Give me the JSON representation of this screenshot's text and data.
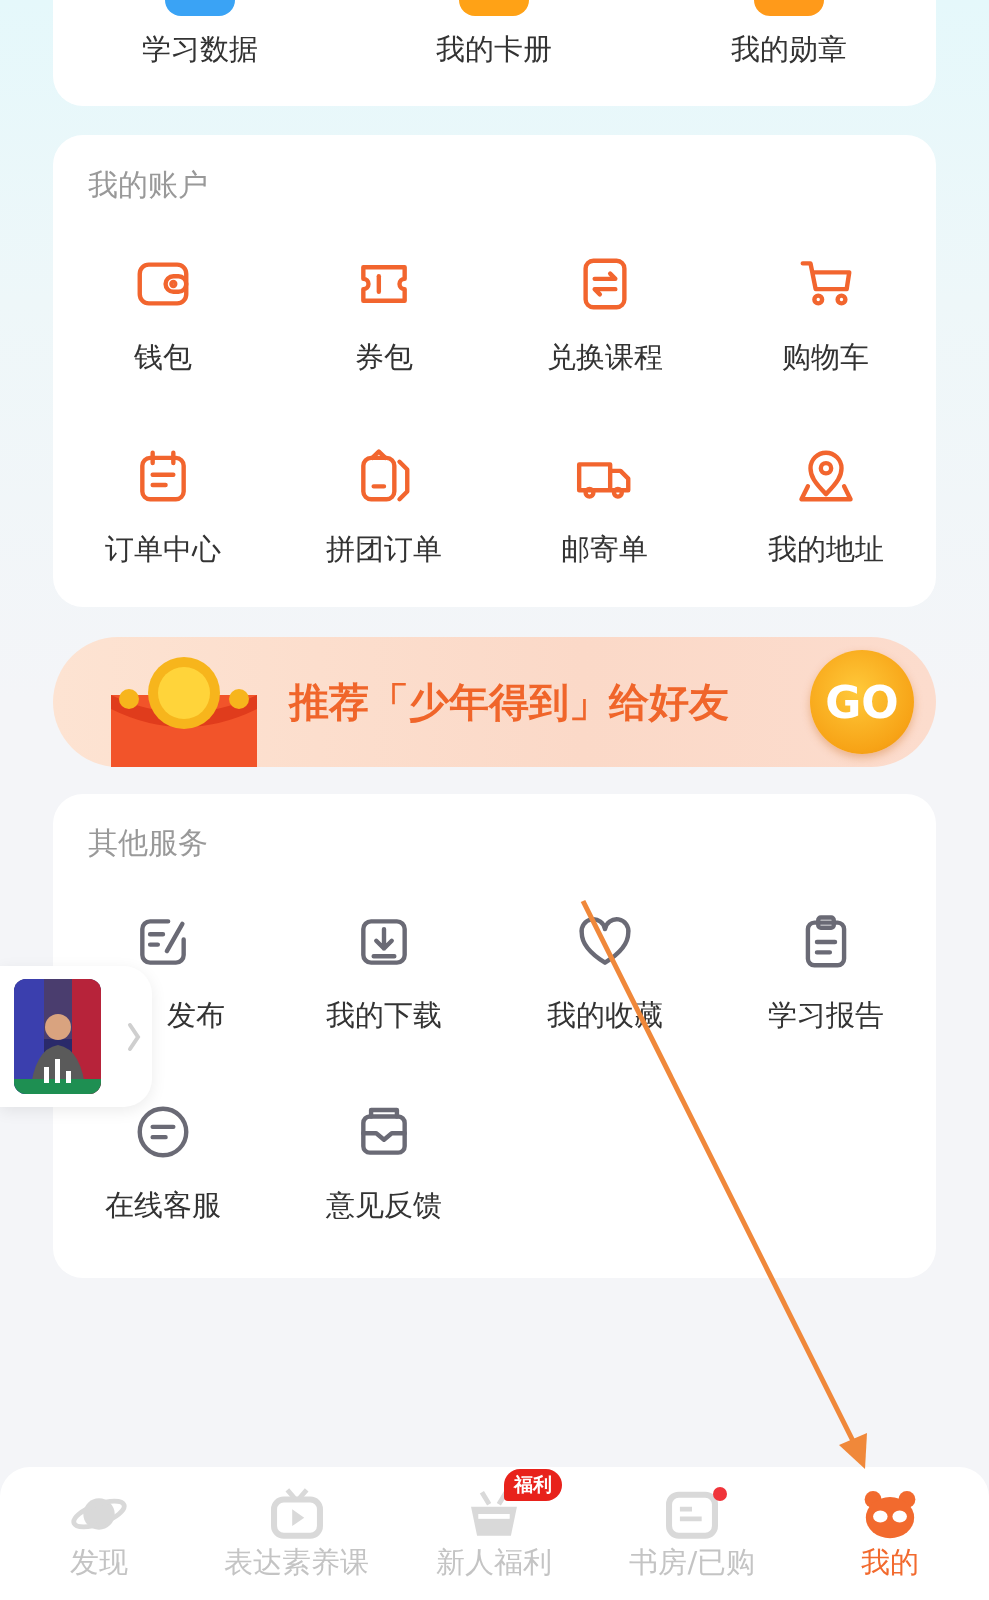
{
  "top_items": [
    {
      "label": "学习数据"
    },
    {
      "label": "我的卡册"
    },
    {
      "label": "我的勋章"
    }
  ],
  "account": {
    "title": "我的账户",
    "items": [
      {
        "label": "钱包"
      },
      {
        "label": "券包"
      },
      {
        "label": "兑换课程"
      },
      {
        "label": "购物车"
      },
      {
        "label": "订单中心"
      },
      {
        "label": "拼团订单"
      },
      {
        "label": "邮寄单"
      },
      {
        "label": "我的地址"
      }
    ]
  },
  "banner": {
    "text": "推荐「少年得到」给好友",
    "button": "GO"
  },
  "services": {
    "title": "其他服务",
    "items": [
      {
        "label": "发布"
      },
      {
        "label": "我的下载"
      },
      {
        "label": "我的收藏"
      },
      {
        "label": "学习报告"
      },
      {
        "label": "在线客服"
      },
      {
        "label": "意见反馈"
      }
    ]
  },
  "tabs": [
    {
      "label": "发现",
      "selected": false,
      "dot": false
    },
    {
      "label": "表达素养课",
      "selected": false,
      "dot": false
    },
    {
      "label": "新人福利",
      "selected": false,
      "dot": false,
      "badge": "福利"
    },
    {
      "label": "书房/已购",
      "selected": false,
      "dot": true
    },
    {
      "label": "我的",
      "selected": true,
      "dot": false
    }
  ]
}
